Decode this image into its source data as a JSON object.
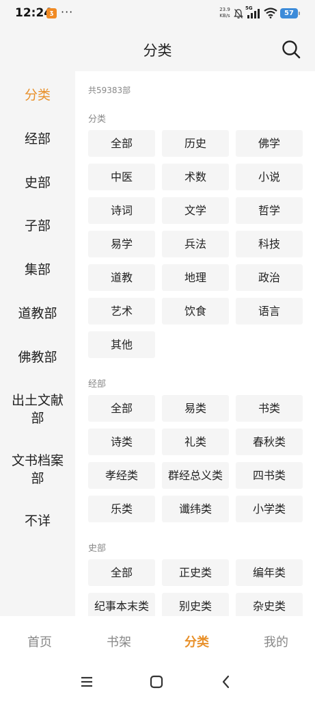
{
  "status_bar": {
    "time": "12:24",
    "app_badge": "ʒ",
    "dots": "···",
    "net_speed_value": "23.9",
    "net_speed_unit": "KB/s",
    "net_type": "5G",
    "battery": "57"
  },
  "header": {
    "title": "分类"
  },
  "sidebar": {
    "items": [
      {
        "label": "分类",
        "active": true
      },
      {
        "label": "经部"
      },
      {
        "label": "史部"
      },
      {
        "label": "子部"
      },
      {
        "label": "集部"
      },
      {
        "label": "道教部"
      },
      {
        "label": "佛教部"
      },
      {
        "label": "出土文献部"
      },
      {
        "label": "文书档案部"
      },
      {
        "label": "不详"
      }
    ]
  },
  "content": {
    "total": "共59383部",
    "sections": [
      {
        "title": "分类",
        "chips": [
          "全部",
          "历史",
          "佛学",
          "中医",
          "术数",
          "小说",
          "诗词",
          "文学",
          "哲学",
          "易学",
          "兵法",
          "科技",
          "道教",
          "地理",
          "政治",
          "艺术",
          "饮食",
          "语言",
          "其他"
        ]
      },
      {
        "title": "经部",
        "chips": [
          "全部",
          "易类",
          "书类",
          "诗类",
          "礼类",
          "春秋类",
          "孝经类",
          "群经总义类",
          "四书类",
          "乐类",
          "谶纬类",
          "小学类"
        ]
      },
      {
        "title": "史部",
        "chips": [
          "全部",
          "正史类",
          "编年类",
          "纪事本末类",
          "别史类",
          "杂史类"
        ]
      }
    ]
  },
  "bottom_nav": {
    "items": [
      {
        "label": "首页"
      },
      {
        "label": "书架"
      },
      {
        "label": "分类",
        "active": true
      },
      {
        "label": "我的"
      }
    ]
  },
  "colors": {
    "accent": "#e8902a",
    "panel_bg": "#f5f5f5",
    "chip_bg": "#f5f5f5",
    "muted_text": "#888888"
  }
}
